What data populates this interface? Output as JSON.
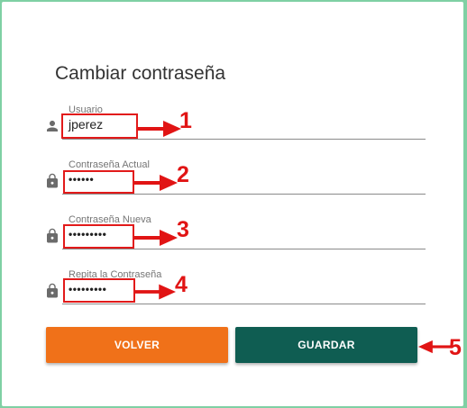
{
  "form": {
    "title": "Cambiar contraseña",
    "fields": [
      {
        "label": "Usuario",
        "value": "jperez",
        "icon": "person-icon",
        "marker": "1"
      },
      {
        "label": "Contraseña Actual",
        "value": "••••••",
        "icon": "lock-icon",
        "marker": "2"
      },
      {
        "label": "Contraseña Nueva",
        "value": "•••••••••",
        "icon": "lock-icon",
        "marker": "3"
      },
      {
        "label": "Repita la Contraseña",
        "value": "•••••••••",
        "icon": "lock-icon",
        "marker": "4"
      }
    ],
    "buttons": {
      "back_label": "VOLVER",
      "save_label": "GUARDAR",
      "save_marker": "5"
    }
  },
  "colors": {
    "back_button": "#f07119",
    "save_button": "#0f5d52",
    "annotation": "#e11414"
  }
}
